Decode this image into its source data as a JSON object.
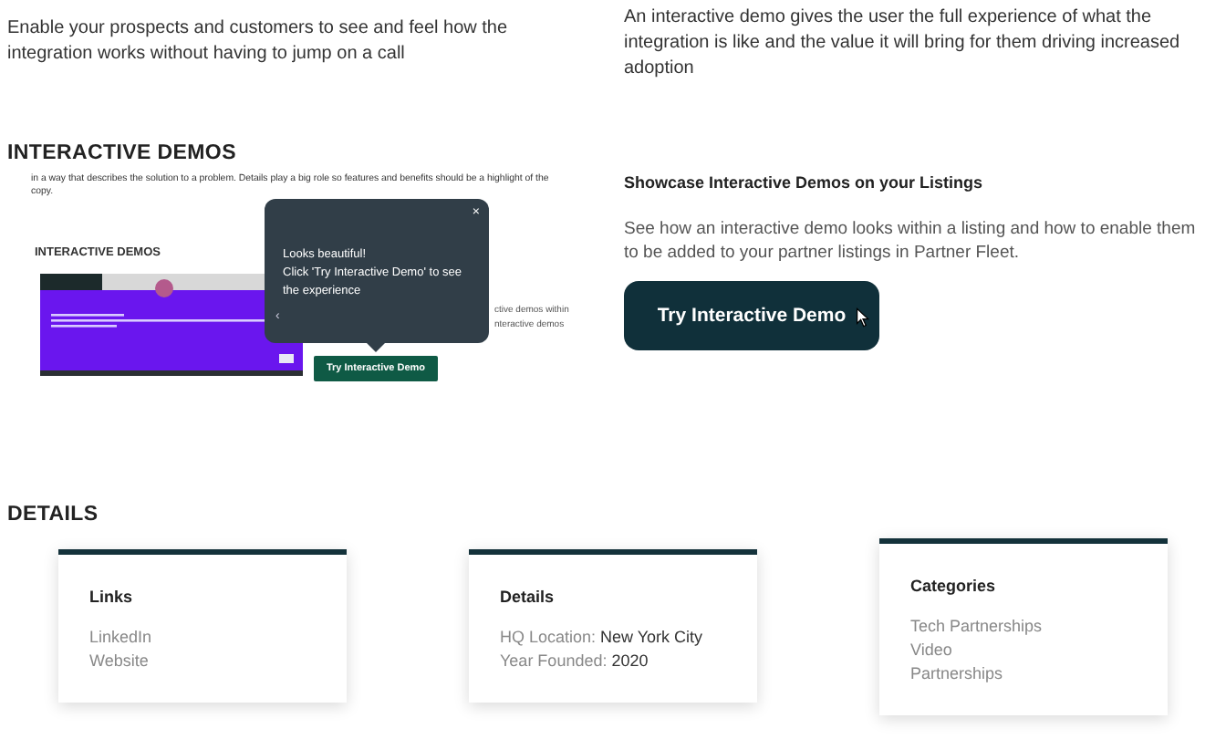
{
  "intro": {
    "left": "Enable your prospects and customers to see and feel how the integration works without having to jump on a call",
    "right": "An interactive demo gives the user the full experience of what the integration is like and the value it will bring for them driving increased adoption"
  },
  "demos": {
    "heading": "INTERACTIVE DEMOS",
    "preview": {
      "text": "in a way that describes the solution to a problem. Details play a big role so features and benefits should be a highlight of the copy.",
      "heading": "INTERACTIVE DEMOS",
      "side_text": [
        "ctive demos within",
        "nteractive demos"
      ],
      "tooltip": {
        "lines": [
          "Looks beautiful!",
          "Click 'Try Interactive Demo' to see the experience"
        ],
        "close": "×",
        "back": "‹"
      },
      "button": "Try Interactive Demo"
    },
    "showcase": {
      "title": "Showcase Interactive Demos on your Listings",
      "text": "See how an interactive demo looks within a listing and how to enable them to be added to your partner listings in Partner Fleet.",
      "button": "Try Interactive Demo"
    }
  },
  "details": {
    "heading": "DETAILS",
    "cards": [
      {
        "title": "Links",
        "items": [
          {
            "kind": "link",
            "text": "LinkedIn"
          },
          {
            "kind": "link",
            "text": "Website"
          }
        ]
      },
      {
        "title": "Details",
        "items": [
          {
            "kind": "field",
            "label": "HQ Location:",
            "value": "New York City"
          },
          {
            "kind": "field",
            "label": "Year Founded:",
            "value": "2020"
          }
        ]
      },
      {
        "title": "Categories",
        "items": [
          {
            "kind": "tag",
            "text": "Tech Partnerships"
          },
          {
            "kind": "tag",
            "text": "Video"
          },
          {
            "kind": "tag",
            "text": "Partnerships"
          }
        ]
      }
    ]
  }
}
